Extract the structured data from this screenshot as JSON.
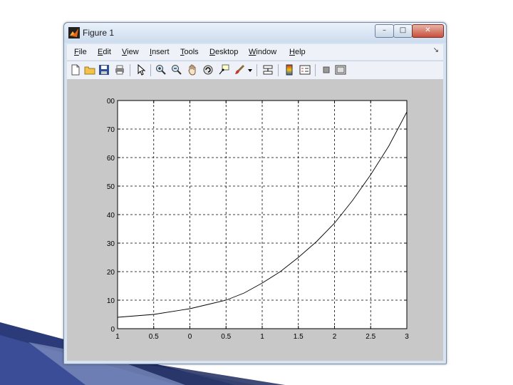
{
  "window": {
    "title": "Figure 1",
    "controls": {
      "minimize": "–",
      "maximize": "□",
      "close": "✕"
    }
  },
  "menu": {
    "items": [
      {
        "key": "F",
        "rest": "ile"
      },
      {
        "key": "E",
        "rest": "dit"
      },
      {
        "key": "V",
        "rest": "iew"
      },
      {
        "key": "I",
        "rest": "nsert"
      },
      {
        "key": "T",
        "rest": "ools"
      },
      {
        "key": "D",
        "rest": "esktop"
      },
      {
        "key": "W",
        "rest": "indow"
      },
      {
        "key": "H",
        "rest": "elp"
      }
    ],
    "dock_glyph": "↘"
  },
  "toolbar": {
    "icons": [
      "new-figure-icon",
      "open-file-icon",
      "save-icon",
      "print-icon",
      "pointer-icon",
      "zoom-in-icon",
      "zoom-out-icon",
      "pan-hand-icon",
      "rotate-3d-icon",
      "data-cursor-icon",
      "brush-icon",
      "dropdown-arrow-icon",
      "link-plot-icon",
      "colorbar-icon",
      "legend-icon",
      "hide-tools-icon",
      "show-tools-icon"
    ]
  },
  "colors": {
    "line": "#000000",
    "axes_bg": "#ffffff",
    "figure_bg": "#c8c8c8"
  },
  "chart_data": {
    "type": "line",
    "title": "",
    "xlabel": "",
    "ylabel": "",
    "xlim": [
      -1,
      3
    ],
    "ylim": [
      0,
      80
    ],
    "grid": true,
    "x_ticks": [
      -1,
      -0.5,
      0,
      0.5,
      1,
      1.5,
      2,
      2.5,
      3
    ],
    "x_tick_labels": [
      "1",
      "0.5",
      "0",
      "0.5",
      "1",
      "1.5",
      "2",
      "2.5",
      "3"
    ],
    "y_ticks": [
      0,
      10,
      20,
      30,
      40,
      50,
      60,
      70,
      80
    ],
    "y_tick_labels": [
      "0",
      "10",
      "20",
      "30",
      "40",
      "50",
      "60",
      "70",
      "00"
    ],
    "series": [
      {
        "x": [
          -1,
          -0.5,
          0,
          0.25,
          0.5,
          0.75,
          1,
          1.25,
          1.5,
          1.75,
          2,
          2.25,
          2.5,
          2.75,
          3
        ],
        "y": [
          4,
          5,
          7,
          8.5,
          10,
          12.5,
          16,
          20,
          25,
          30.5,
          37,
          45,
          54,
          64,
          76
        ]
      }
    ]
  }
}
